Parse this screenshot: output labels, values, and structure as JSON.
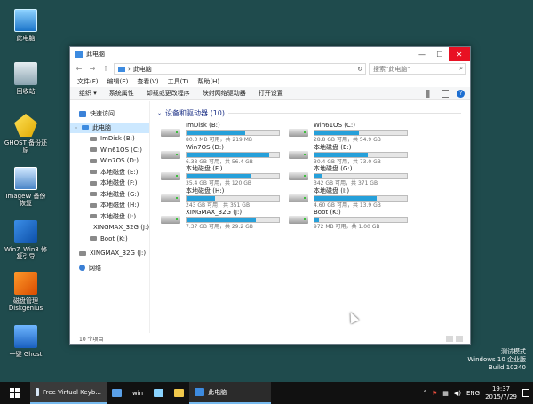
{
  "desktop": {
    "icons": [
      {
        "label": "此电脑",
        "icon": "computer-icon"
      },
      {
        "label": "回收站",
        "icon": "recycle-bin-icon"
      },
      {
        "label": "GHOST 备份还原",
        "icon": "ghost-icon"
      },
      {
        "label": "ImageW 备份恢复",
        "icon": "imagew-icon"
      },
      {
        "label": "Win7_Win8 修复引导",
        "icon": "win7-icon"
      },
      {
        "label": "磁盘管理 Diskgenius",
        "icon": "diskgenius-icon"
      },
      {
        "label": "一键 Ghost",
        "icon": "one-key-ghost-icon"
      }
    ]
  },
  "window": {
    "title": "此电脑",
    "controls": {
      "minimize": "—",
      "maximize": "☐",
      "close": "✕"
    },
    "address": {
      "path": "此电脑",
      "separator": "›"
    },
    "search": {
      "placeholder": "搜索\"此电脑\""
    },
    "menu": [
      "文件(F)",
      "编辑(E)",
      "查看(V)",
      "工具(T)",
      "帮助(H)"
    ],
    "toolbar": {
      "organize": "组织 ▾",
      "items": [
        "系统属性",
        "卸载或更改程序",
        "映射网络驱动器",
        "打开设置"
      ]
    },
    "nav": {
      "quick_access": "快速访问",
      "this_pc": "此电脑",
      "drives": [
        "ImDisk (B:)",
        "Win61OS (C:)",
        "Win7OS (D:)",
        "本地磁盘 (E:)",
        "本地磁盘 (F:)",
        "本地磁盘 (G:)",
        "本地磁盘 (H:)",
        "本地磁盘 (I:)",
        "XINGMAX_32G (J:)",
        "Boot (K:)"
      ],
      "usb": "XINGMAX_32G (J:)",
      "network": "网络"
    },
    "group": {
      "header": "设备和驱动器 (10)"
    },
    "drives": [
      {
        "name": "ImDisk (B:)",
        "free": "80.3 MB 可用，共 219 MB",
        "used": 0.63
      },
      {
        "name": "Win61OS (C:)",
        "free": "28.8 GB 可用，共 54.9 GB",
        "used": 0.48
      },
      {
        "name": "Win7OS (D:)",
        "free": "6.38 GB 可用，共 56.4 GB",
        "used": 0.89
      },
      {
        "name": "本地磁盘 (E:)",
        "free": "30.4 GB 可用，共 73.0 GB",
        "used": 0.58
      },
      {
        "name": "本地磁盘 (F:)",
        "free": "35.4 GB 可用，共 120 GB",
        "used": 0.7
      },
      {
        "name": "本地磁盘 (G:)",
        "free": "342 GB 可用，共 371 GB",
        "used": 0.08
      },
      {
        "name": "本地磁盘 (H:)",
        "free": "243 GB 可用，共 351 GB",
        "used": 0.31
      },
      {
        "name": "本地磁盘 (I:)",
        "free": "4.60 GB 可用，共 13.9 GB",
        "used": 0.67
      },
      {
        "name": "XINGMAX_32G (J:)",
        "free": "7.37 GB 可用，共 29.2 GB",
        "used": 0.75
      },
      {
        "name": "Boot (K:)",
        "free": "972 MB 可用，共 1.00 GB",
        "used": 0.05
      }
    ],
    "status": "10 个项目"
  },
  "watermark": [
    "测试模式",
    "Windows 10 企业版",
    "Build 10240"
  ],
  "taskbar": {
    "apps": [
      {
        "label": "Free Virtual Keyb...",
        "icon": "keyboard-icon"
      },
      {
        "label": "",
        "icon": "monitor-icon"
      },
      {
        "label": "win",
        "icon": "win-app-icon"
      },
      {
        "label": "",
        "icon": "pencil-icon"
      },
      {
        "label": "",
        "icon": "folder-icon"
      },
      {
        "label": "此电脑",
        "icon": "computer-icon"
      }
    ],
    "tray": {
      "language": "ENG",
      "time": "19:37",
      "date": "2015/7/29"
    }
  },
  "colors": {
    "accent": "#26a0da",
    "desktop": "#1f4b4d",
    "close": "#e81123",
    "taskbar": "#111111"
  }
}
